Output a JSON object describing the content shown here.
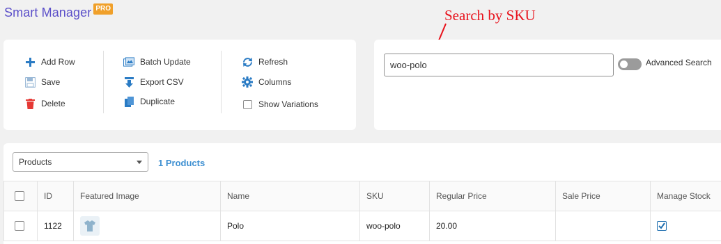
{
  "app": {
    "title": "Smart Manager",
    "badge": "PRO"
  },
  "annotation": {
    "text": "Search by SKU",
    "color": "#e8111b"
  },
  "toolbar": {
    "add_row": "Add Row",
    "save": "Save",
    "delete": "Delete",
    "batch_update": "Batch Update",
    "export_csv": "Export CSV",
    "duplicate": "Duplicate",
    "refresh": "Refresh",
    "columns": "Columns",
    "show_variations": "Show Variations"
  },
  "search": {
    "value": "woo-polo",
    "advanced_label": "Advanced Search",
    "advanced_enabled": false
  },
  "grid": {
    "dashboard_select": "Products",
    "count_label": "1 Products",
    "columns": [
      "ID",
      "Featured Image",
      "Name",
      "SKU",
      "Regular Price",
      "Sale Price",
      "Manage Stock"
    ],
    "rows": [
      {
        "id": "1122",
        "name": "Polo",
        "sku": "woo-polo",
        "regular_price": "20.00",
        "sale_price": "",
        "manage_stock": true
      }
    ]
  },
  "colors": {
    "accent": "#5b4fc9",
    "badge": "#f0a02a",
    "link": "#3d8fd1",
    "delete_icon": "#e53935",
    "icon_blue": "#2a7bc4"
  }
}
